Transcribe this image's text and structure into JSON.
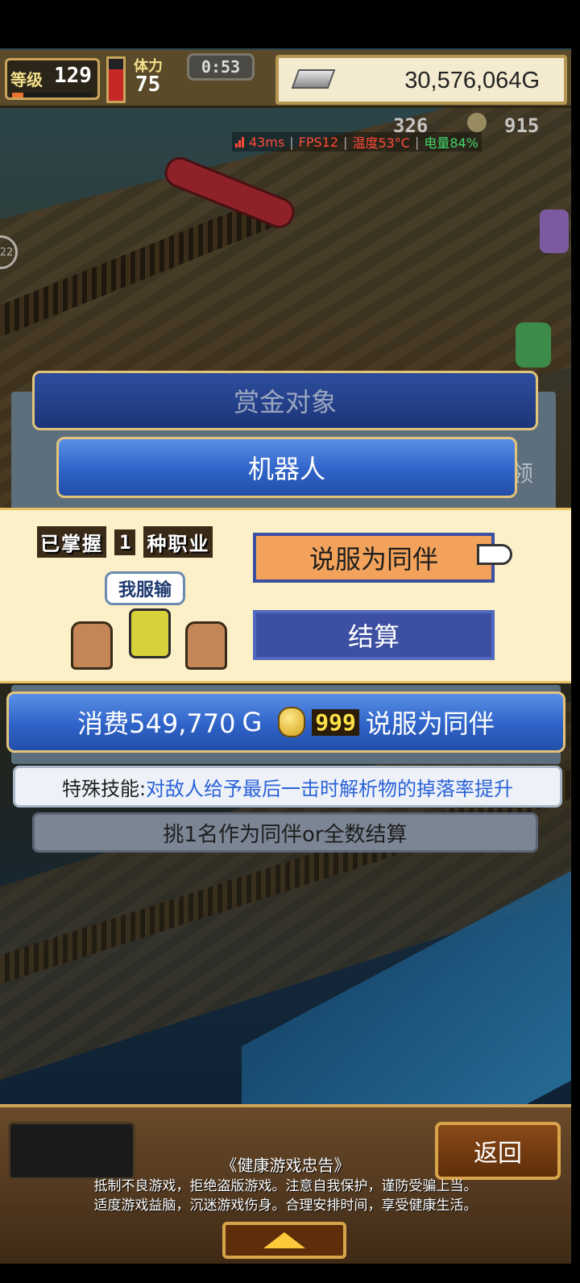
{
  "hud": {
    "level_label": "等级",
    "level_value": "129",
    "stamina_label": "体力",
    "stamina_value": "75",
    "timer": "0:53",
    "gold": "30,576,064G",
    "counter_a": "326",
    "counter_b": "915"
  },
  "perf_overlay": {
    "latency": "43ms",
    "fps": "FPS12",
    "temperature": "温度53°C",
    "battery": "电量84%",
    "separator": "|"
  },
  "side_badge": "22",
  "bounty": {
    "header": "赏金对象",
    "target_name": "机器人",
    "partial_text": "领"
  },
  "recruit_panel": {
    "mastered_prefix": "已掌握",
    "mastered_count": "1",
    "mastered_suffix": "种职业",
    "speech_bubble": "我服输",
    "persuade_button": "说服为同伴",
    "settle_button": "结算"
  },
  "cost_bar": {
    "cost_prefix": "消费549,770",
    "cost_unit": "G",
    "medal_count": "999",
    "cost_suffix": "说服为同伴"
  },
  "skill": {
    "label": "特殊技能:",
    "description": "对敌人给予最后一击时解析物的掉落率提升"
  },
  "hint": "挑1名作为同伴or全数结算",
  "bottom": {
    "back_button": "返回",
    "notice_title": "《健康游戏忠告》",
    "notice_line1": "抵制不良游戏，拒绝盗版游戏。注意自我保护，谨防受骗上当。",
    "notice_line2": "适度游戏益脑，沉迷游戏伤身。合理安排时间，享受健康生活。"
  },
  "colors": {
    "accent_blue": "#2f63c8",
    "persuade_orange": "#f2a25a",
    "settle_navy": "#3c4fa0",
    "skill_text_blue": "#2a62d8",
    "perf_red": "#ff4a3a",
    "perf_green": "#43d66b"
  }
}
